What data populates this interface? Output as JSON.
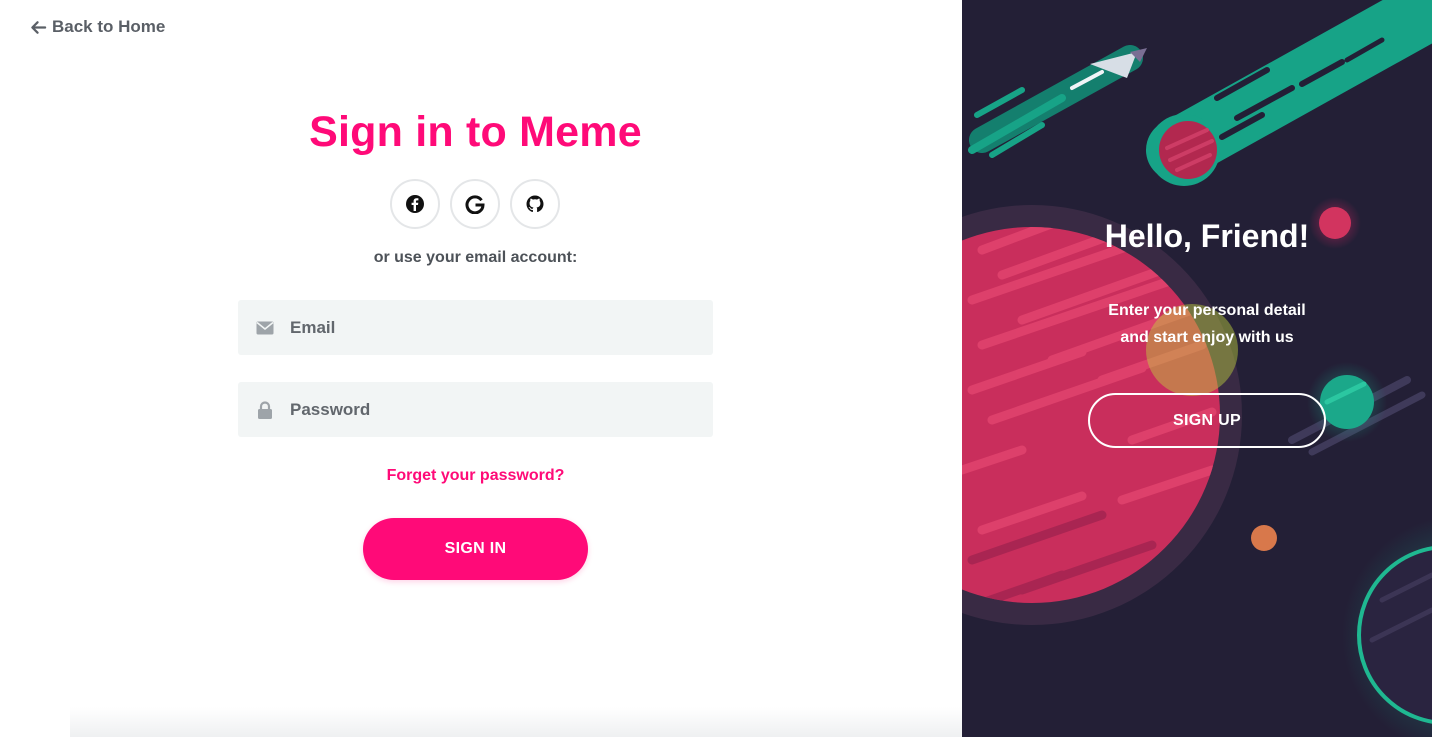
{
  "nav": {
    "back_label": "Back to Home",
    "back_icon": "arrow-left-icon"
  },
  "signin": {
    "title": "Sign in to Meme",
    "social_icons": [
      "facebook-icon",
      "google-icon",
      "github-icon"
    ],
    "or_text": "or use your email account:",
    "email_placeholder": "Email",
    "password_placeholder": "Password",
    "forgot_label": "Forget your password?",
    "submit_label": "SIGN IN"
  },
  "panel": {
    "heading": "Hello, Friend!",
    "line1": "Enter your personal detail",
    "line2": "and start enjoy with us",
    "signup_label": "SIGN UP"
  },
  "colors": {
    "accent": "#ff0a78",
    "panel_bg": "#231f36",
    "field_bg": "#f2f5f5",
    "teal": "#16a085"
  }
}
